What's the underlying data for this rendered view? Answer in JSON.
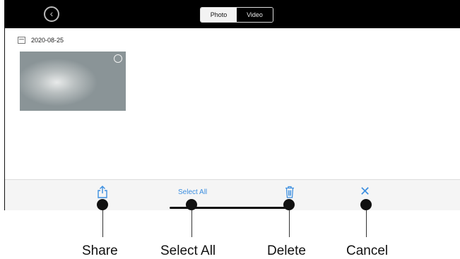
{
  "topbar": {
    "back_icon": "back-circle-icon",
    "tabs": [
      {
        "label": "Photo",
        "active": true
      },
      {
        "label": "Video",
        "active": false
      }
    ]
  },
  "gallery": {
    "date": "2020-08-25",
    "date_icon": "calendar-icon"
  },
  "toolbar": {
    "share_icon": "share-icon",
    "select_all_label": "Select All",
    "delete_icon": "trash-icon",
    "cancel_icon": "close-icon",
    "accent_color": "#3d8fe0"
  },
  "callouts": [
    {
      "label": "Share"
    },
    {
      "label": "Select All"
    },
    {
      "label": "Delete"
    },
    {
      "label": "Cancel"
    }
  ]
}
